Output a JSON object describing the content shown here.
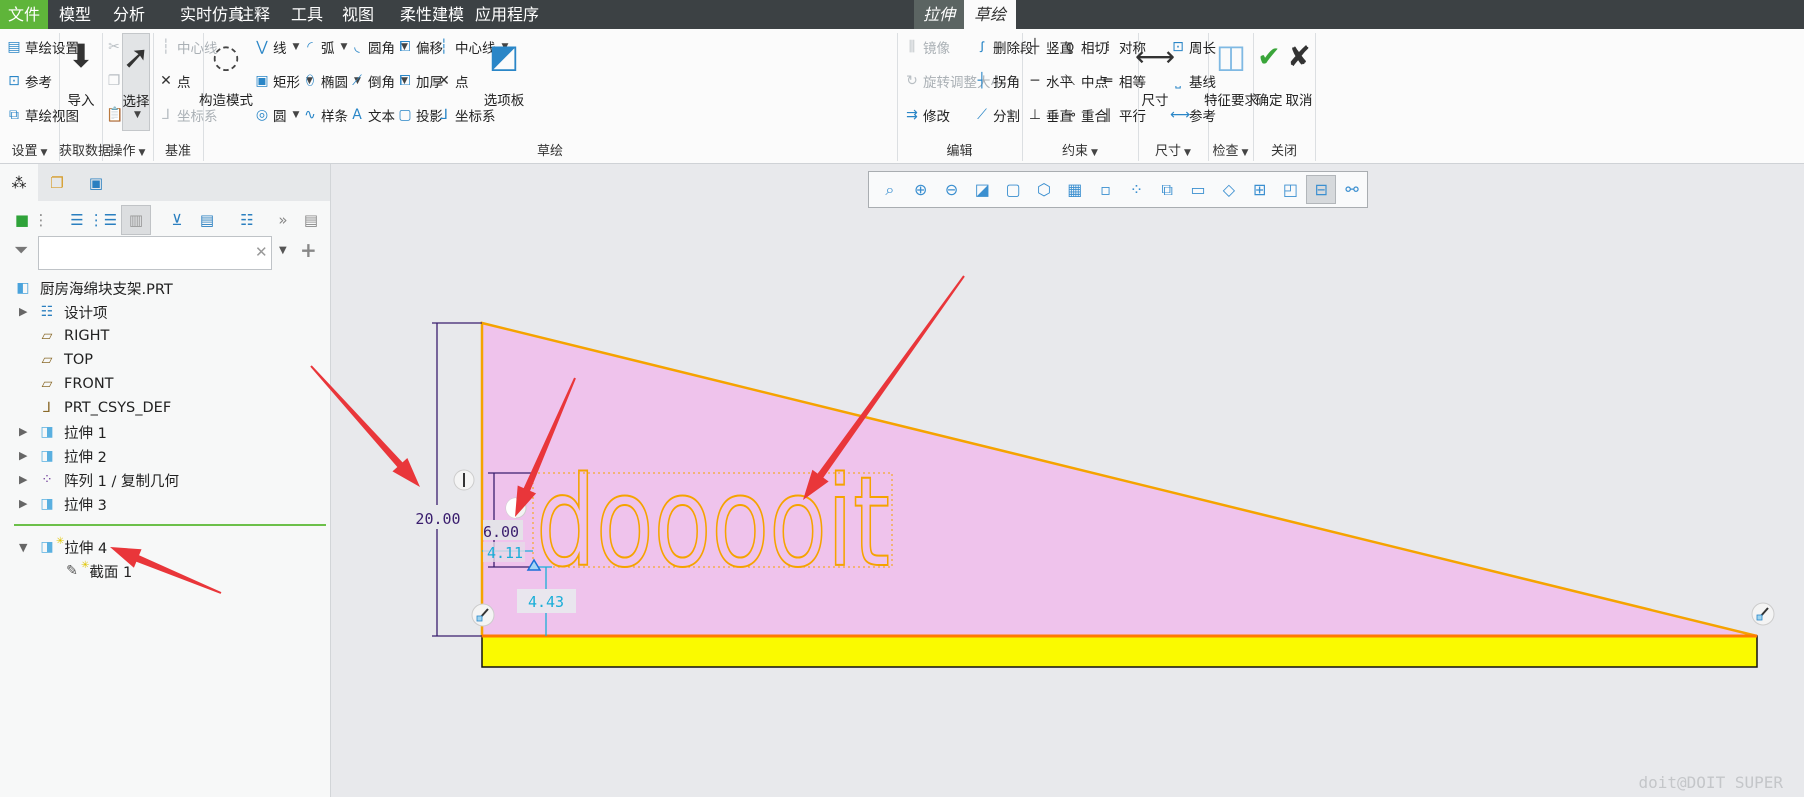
{
  "menu_tabs": [
    {
      "label": "文件",
      "state": "file"
    },
    {
      "label": "模型"
    },
    {
      "label": "分析"
    },
    {
      "label": "实时仿真"
    },
    {
      "label": "注释"
    },
    {
      "label": "工具"
    },
    {
      "label": "视图"
    },
    {
      "label": "柔性建模"
    },
    {
      "label": "应用程序"
    },
    {
      "label": "拉伸",
      "state": "context"
    },
    {
      "label": "草绘",
      "state": "active"
    }
  ],
  "colors": {
    "file_tab": "#5fb53a",
    "menubar": "#3c4144",
    "sketch_fill": "#efc3ec",
    "sketch_line": "#f5a300",
    "yellow_face": "#fafa00",
    "dim_purple": "#3a1e6e",
    "dim_cyan": "#1aaed8",
    "arrow_red": "#e9363a",
    "tree_separator": "#6cc04a"
  },
  "ribbon": {
    "groups": [
      {
        "label": "设置",
        "dropdown": true,
        "items": [
          {
            "label": "草绘设置",
            "icon": "sketch-setup-icon"
          },
          {
            "label": "参考",
            "icon": "reference-icon"
          },
          {
            "label": "草绘视图",
            "icon": "sketch-view-icon"
          }
        ]
      },
      {
        "label": "获取数据",
        "items": [
          {
            "label": "导入",
            "icon": "import-icon"
          }
        ]
      },
      {
        "label": "操作",
        "dropdown": true,
        "items": [
          {
            "label": "",
            "icon": "cut-icon",
            "disabled": true
          },
          {
            "label": "",
            "icon": "copy-icon",
            "disabled": true
          },
          {
            "label": "",
            "icon": "paste-icon",
            "disabled": true
          },
          {
            "label": "选择",
            "icon": "select-arrow-icon",
            "dropdown": true
          }
        ]
      },
      {
        "label": "基准",
        "items": [
          {
            "label": "中心线",
            "icon": "centerline-icon",
            "disabled": true
          },
          {
            "label": "点",
            "icon": "point-icon"
          },
          {
            "label": "坐标系",
            "icon": "csys-icon",
            "disabled": true
          }
        ]
      },
      {
        "label": "草绘",
        "items": [
          {
            "label": "构造模式",
            "icon": "construction-mode-icon"
          },
          {
            "label": "线",
            "icon": "line-icon",
            "dropdown": true
          },
          {
            "label": "矩形",
            "icon": "rectangle-icon",
            "dropdown": true
          },
          {
            "label": "圆",
            "icon": "circle-icon",
            "dropdown": true
          },
          {
            "label": "弧",
            "icon": "arc-icon",
            "dropdown": true
          },
          {
            "label": "椭圆",
            "icon": "ellipse-icon",
            "dropdown": true
          },
          {
            "label": "样条",
            "icon": "spline-icon"
          },
          {
            "label": "圆角",
            "icon": "fillet-icon",
            "dropdown": true
          },
          {
            "label": "倒角",
            "icon": "chamfer-icon",
            "dropdown": true
          },
          {
            "label": "文本",
            "icon": "text-icon"
          },
          {
            "label": "偏移",
            "icon": "offset-icon"
          },
          {
            "label": "加厚",
            "icon": "thicken-icon"
          },
          {
            "label": "投影",
            "icon": "project-icon"
          },
          {
            "label": "中心线",
            "icon": "centerline-icon",
            "dropdown": true
          },
          {
            "label": "点",
            "icon": "point-icon"
          },
          {
            "label": "坐标系",
            "icon": "csys-icon"
          },
          {
            "label": "选项板",
            "icon": "palette-icon"
          }
        ]
      },
      {
        "label": "编辑",
        "items": [
          {
            "label": "镜像",
            "icon": "mirror-icon",
            "disabled": true
          },
          {
            "label": "旋转调整大小",
            "icon": "rotate-resize-icon",
            "disabled": true
          },
          {
            "label": "修改",
            "icon": "modify-icon"
          },
          {
            "label": "删除段",
            "icon": "delete-segment-icon"
          },
          {
            "label": "拐角",
            "icon": "corner-icon"
          },
          {
            "label": "分割",
            "icon": "divide-icon"
          }
        ]
      },
      {
        "label": "约束",
        "dropdown": true,
        "items": [
          {
            "label": "竖直",
            "icon": "vertical-icon"
          },
          {
            "label": "水平",
            "icon": "horizontal-icon"
          },
          {
            "label": "垂直",
            "icon": "perpendicular-icon"
          },
          {
            "label": "相切",
            "icon": "tangent-icon"
          },
          {
            "label": "中点",
            "icon": "midpoint-icon"
          },
          {
            "label": "重合",
            "icon": "coincident-icon"
          },
          {
            "label": "对称",
            "icon": "symmetric-icon"
          },
          {
            "label": "相等",
            "icon": "equal-icon"
          },
          {
            "label": "平行",
            "icon": "parallel-icon"
          }
        ]
      },
      {
        "label": "尺寸",
        "dropdown": true,
        "items": [
          {
            "label": "尺寸",
            "icon": "dimension-icon"
          },
          {
            "label": "周长",
            "icon": "perimeter-icon"
          },
          {
            "label": "基线",
            "icon": "baseline-icon"
          },
          {
            "label": "参考",
            "icon": "reference-dim-icon"
          }
        ]
      },
      {
        "label": "检查",
        "dropdown": true,
        "items": [
          {
            "label": "特征要求",
            "icon": "feature-requirements-icon"
          }
        ]
      },
      {
        "label": "关闭",
        "items": [
          {
            "label": "确定",
            "icon": "ok-check-icon"
          },
          {
            "label": "取消",
            "icon": "cancel-x-icon"
          }
        ]
      }
    ]
  },
  "left_panel": {
    "tabs": [
      {
        "icon": "model-tree-icon",
        "active": true
      },
      {
        "icon": "layers-icon"
      },
      {
        "icon": "favorites-folder-icon"
      }
    ],
    "toolbar": [
      "part-cube-icon",
      "grip-icon",
      "tree-columns-icon",
      "tree-expand-icon",
      "show-hide-icon",
      "tree-filter-icon",
      "tree-settings-icon",
      "details-icon",
      "more-icon",
      "notes-icon"
    ],
    "search": {
      "value": "",
      "placeholder": ""
    },
    "tree": {
      "root": "厨房海绵块支架.PRT",
      "items": [
        {
          "label": "设计项",
          "icon": "design-items-icon",
          "expandable": true
        },
        {
          "label": "RIGHT",
          "icon": "datum-plane-icon"
        },
        {
          "label": "TOP",
          "icon": "datum-plane-icon"
        },
        {
          "label": "FRONT",
          "icon": "datum-plane-icon"
        },
        {
          "label": "PRT_CSYS_DEF",
          "icon": "csys-icon"
        },
        {
          "label": "拉伸 1",
          "icon": "extrude-icon",
          "expandable": true
        },
        {
          "label": "拉伸 2",
          "icon": "extrude-icon",
          "expandable": true
        },
        {
          "label": "阵列 1 / 复制几何",
          "icon": "pattern-icon",
          "expandable": true
        },
        {
          "label": "拉伸 3",
          "icon": "extrude-icon",
          "expandable": true
        }
      ],
      "active": {
        "label": "拉伸 4",
        "icon": "extrude-icon",
        "expanded": true,
        "child": {
          "label": "截面 1",
          "icon": "sketch-section-icon"
        }
      }
    }
  },
  "graphics_toolbar": [
    "refit-icon",
    "zoom-in-icon",
    "zoom-out-icon",
    "repaint-icon",
    "display-style-icon",
    "saved-orientations-icon",
    "view-manager-icon",
    "sketch-view-icon",
    "datum-display-icon",
    "spin-center-icon",
    "annotation-display-icon",
    "perspective-icon",
    "dimension-display-icon",
    "constraint-display-icon",
    "grid-display-icon",
    "vertex-display-icon"
  ],
  "graphics_toolbar_pressed": 14,
  "sketch": {
    "text": "dooooit",
    "dims": {
      "height": "20.00",
      "text_height": "6.00",
      "text_offset_x": "4.11",
      "text_offset_y": "4.43"
    }
  },
  "watermark": "doit@DOIT SUPER"
}
